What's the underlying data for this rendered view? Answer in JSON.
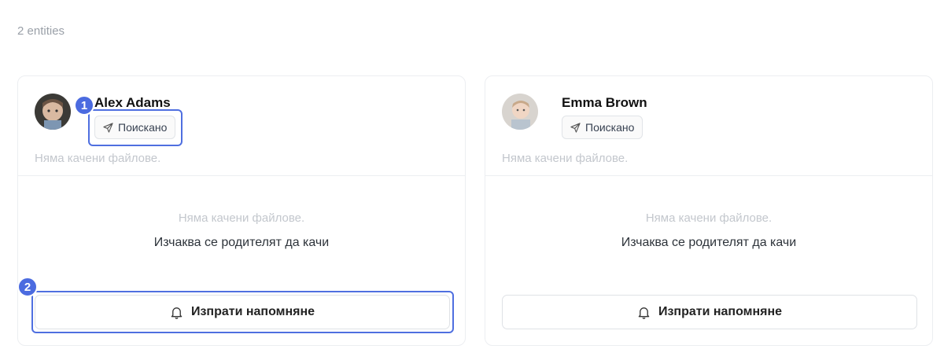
{
  "header": {
    "count_text": "2 entities"
  },
  "cards": [
    {
      "name": "Alex Adams",
      "badge": "Поискано",
      "no_files_top": "Няма качени файлове.",
      "no_files": "Няма качени файлове.",
      "waiting": "Изчаква се родителят да качи",
      "button": "Изпрати напомняне"
    },
    {
      "name": "Emma Brown",
      "badge": "Поискано",
      "no_files_top": "Няма качени файлове.",
      "no_files": "Няма качени файлове.",
      "waiting": "Изчаква се родителят да качи",
      "button": "Изпрати напомняне"
    }
  ],
  "annotations": {
    "marker_1": "1",
    "marker_2": "2"
  },
  "colors": {
    "annotation": "#4f6fe0",
    "muted_text": "#c3c7cd",
    "border": "#eceef1"
  }
}
